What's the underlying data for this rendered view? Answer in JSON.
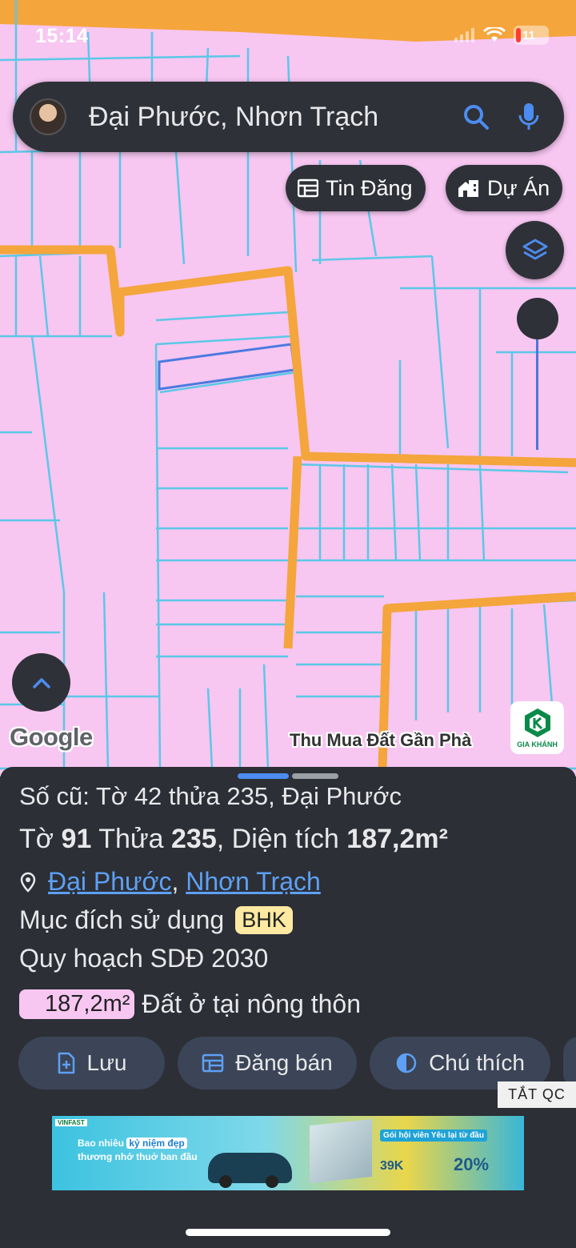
{
  "status": {
    "time": "15:14",
    "battery": "11"
  },
  "search": {
    "text": "Đại Phước, Nhơn Trạch"
  },
  "chips": {
    "listings": "Tin Đăng",
    "projects": "Dự Án"
  },
  "map": {
    "attribution": "Google",
    "poi_label": "Thu Mua Đất Gần Phà",
    "brand_logo": "GIA KHÁNH"
  },
  "sheet": {
    "old_id": "Số cũ: Tờ 42 thửa 235, Đại Phước",
    "parcel": {
      "sheet_label": "Tờ",
      "sheet": "91",
      "lot_label": "Thửa",
      "lot": "235",
      "area_label": ", Diện tích",
      "area": "187,2m²"
    },
    "location": {
      "ward": "Đại Phước",
      "separator": ",",
      "district": "Nhơn Trạch"
    },
    "purpose": {
      "label": "Mục đích sử dụng",
      "code": "BHK"
    },
    "plan": "Quy hoạch SDĐ 2030",
    "land": {
      "area": "187,2m²",
      "type": "Đất ở tại nông thôn"
    },
    "actions": {
      "save": "Lưu",
      "sell": "Đăng bán",
      "legend": "Chú thích"
    }
  },
  "ad": {
    "close": "TẮT QC",
    "headline_1": "Bao nhiêu",
    "headline_hl": "kỷ niệm đẹp",
    "headline_2": "thương nhớ thuở ban đầu",
    "offer": "Gói hội viên Yêu lại từ đầu",
    "price": "39K",
    "discount": "20%"
  },
  "colors": {
    "land_pink": "#f7c6f1",
    "parcel_line": "#5bc8e6",
    "road": "#f4a53c",
    "sheet_bg": "#2c2f36",
    "link": "#5ea0f4",
    "accent": "#4c8cf0"
  }
}
